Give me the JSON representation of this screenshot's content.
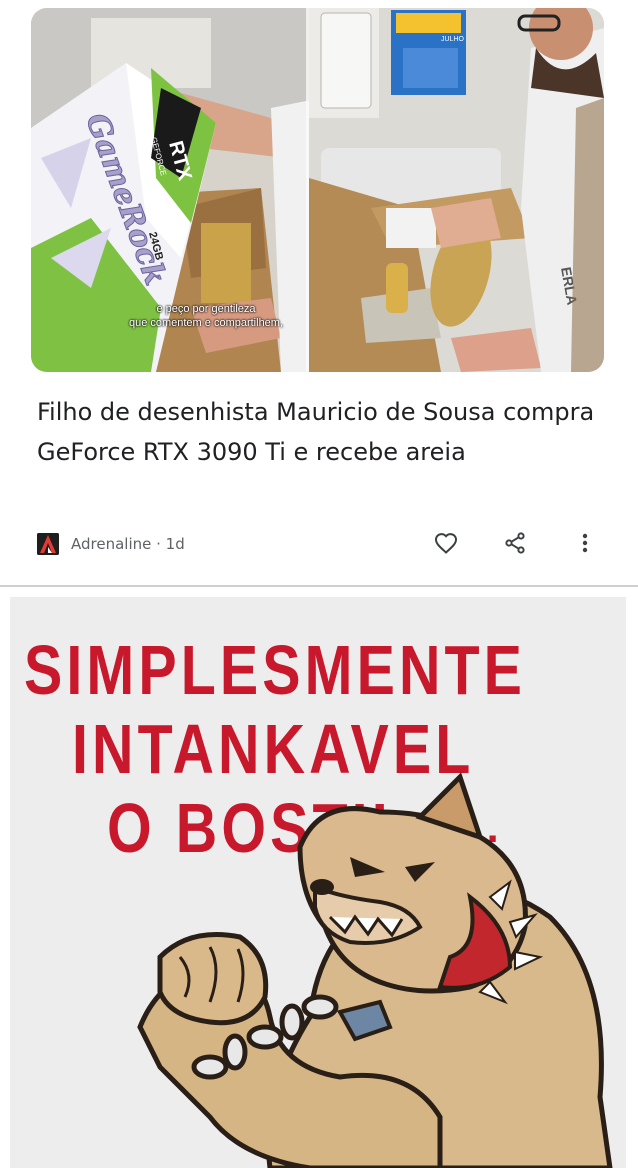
{
  "article": {
    "thumbnail": {
      "box_brand": "GameRock",
      "box_model": "RTX",
      "box_series": "GEFORCE",
      "box_memory": "24GB",
      "calendar_month": "JULHO",
      "overlay_caption_line1": "e peço por gentileza",
      "overlay_caption_line2": "que comentem e compartilhem,"
    },
    "title": "Filho de desenhista Mauricio de Sousa compra GeForce RTX 3090 Ti e recebe areia",
    "source": {
      "logo_letter": "A",
      "name": "Adrenaline",
      "age": "1d",
      "meta": "Adrenaline · 1d"
    },
    "actions": {
      "like_icon": "heart-outline-icon",
      "share_icon": "share-icon",
      "more_icon": "more-vert-icon"
    }
  },
  "meme": {
    "line1": "SIMPLESMENTE",
    "line2": "INTANKAVEL",
    "line3": "O BOSTIL",
    "dots": "...",
    "colors": {
      "text": "#c8182c",
      "background": "#ededed"
    }
  },
  "colors": {
    "title": "#202124",
    "meta": "#5f6368",
    "logo_accent": "#e53935"
  }
}
